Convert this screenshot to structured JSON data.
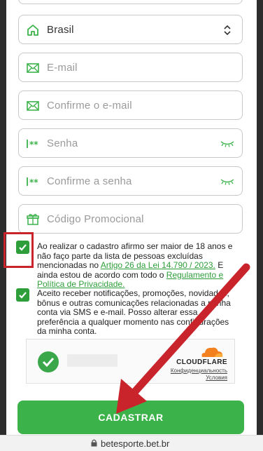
{
  "form": {
    "country_value": "Brasil",
    "email_placeholder": "E-mail",
    "confirm_email_placeholder": "Confirme o e-mail",
    "password_placeholder": "Senha",
    "confirm_password_placeholder": "Confirme a senha",
    "promo_placeholder": "Código Promocional"
  },
  "terms": {
    "text_before": "Ao realizar o cadastro afirmo ser maior de 18 anos e não faço parte da lista de pessoas excluídas mencionadas no ",
    "law_link": "Artigo 26 da Lei 14.790 / 2023.",
    "text_middle": " E ainda estou de acordo com todo o ",
    "regulation_link": "Regulamento e Política de Privacidade."
  },
  "notifications": {
    "text": "Aceito receber notificações, promoções, novidades, bônus e outras comunicações relacionadas a minha conta via SMS e e-mail. Posso alterar essa preferência a qualquer momento nas configurações da minha conta."
  },
  "captcha": {
    "brand": "CLOUDFLARE",
    "privacy_link": "Конфиденциальность",
    "terms_link": "Условия"
  },
  "submit_label": "CADASTRAR",
  "browser": {
    "url": "betesporte.bet.br"
  },
  "colors": {
    "accent_green": "#3bb24a",
    "highlight_red": "#c9242b",
    "arrow_red": "#c9242b"
  },
  "icons": [
    "home-icon",
    "chevron-updown-icon",
    "mail-icon",
    "password-icon",
    "eye-closed-icon",
    "gift-icon",
    "check-icon",
    "lock-icon",
    "cloudflare-logo"
  ]
}
